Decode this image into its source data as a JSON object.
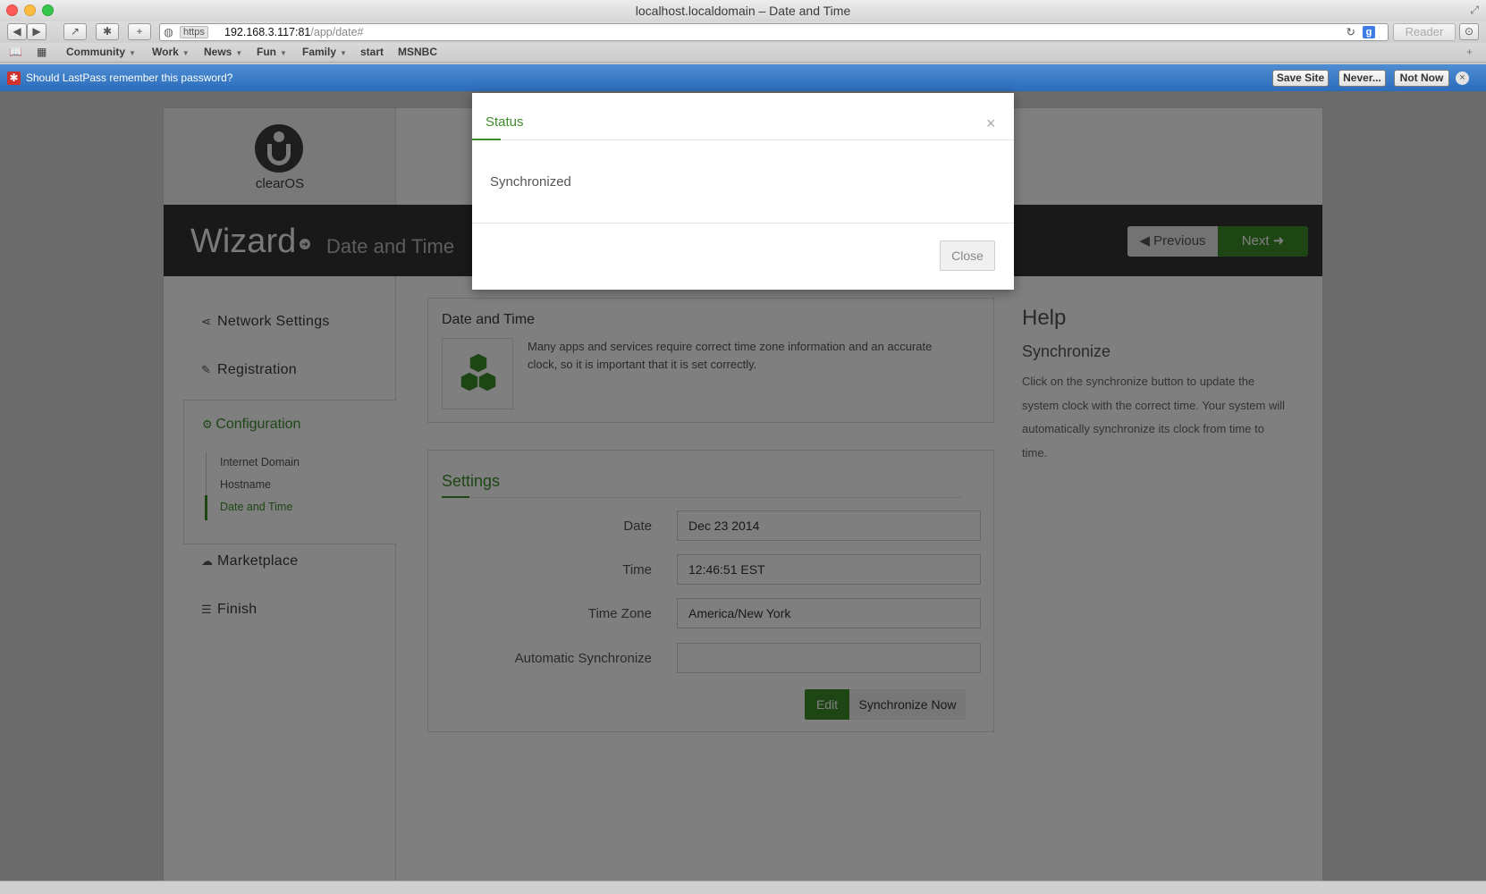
{
  "browser": {
    "window_title": "localhost.localdomain – Date and Time",
    "url_scheme": "https",
    "url_host": "192.168.3.117:81",
    "url_path": "/app/date#",
    "reader_label": "Reader",
    "bookmarks": [
      {
        "label": "Community",
        "menu": true
      },
      {
        "label": "Work",
        "menu": true
      },
      {
        "label": "News",
        "menu": true
      },
      {
        "label": "Fun",
        "menu": true
      },
      {
        "label": "Family",
        "menu": true
      },
      {
        "label": "start",
        "menu": false
      },
      {
        "label": "MSNBC",
        "menu": false
      }
    ]
  },
  "lastpass": {
    "message": "Should LastPass remember this password?",
    "save_site": "Save Site",
    "never": "Never...",
    "not_now": "Not Now"
  },
  "app": {
    "logo_text": "clearOS",
    "wizard_title": "Wizard",
    "wizard_step": "Date and Time",
    "prev_label": "Previous",
    "next_label": "Next",
    "nav": {
      "network": "Network Settings",
      "registration": "Registration",
      "configuration": "Configuration",
      "sub": [
        "Internet Domain",
        "Hostname",
        "Date and Time"
      ],
      "marketplace": "Marketplace",
      "finish": "Finish"
    },
    "info_panel": {
      "title": "Date and Time",
      "description": "Many apps and services require correct time zone information and an accurate clock, so it is important that it is set correctly."
    },
    "settings": {
      "title": "Settings",
      "fields": [
        {
          "label": "Date",
          "value": "Dec 23 2014"
        },
        {
          "label": "Time",
          "value": "12:46:51 EST"
        },
        {
          "label": "Time Zone",
          "value": "America/New York"
        },
        {
          "label": "Automatic Synchronize",
          "value": ""
        }
      ],
      "edit_label": "Edit",
      "sync_label": "Synchronize Now"
    },
    "help": {
      "title": "Help",
      "subtitle": "Synchronize",
      "text": "Click on the synchronize button to update the system clock with the correct time. Your system will automatically synchronize its clock from time to time."
    }
  },
  "modal": {
    "title": "Status",
    "close_x": "×",
    "body": "Synchronized",
    "close_label": "Close"
  },
  "colors": {
    "accent_green": "#3d8c2a",
    "lastpass_blue": "#2b6cbc",
    "wizard_bar": "#333333"
  }
}
